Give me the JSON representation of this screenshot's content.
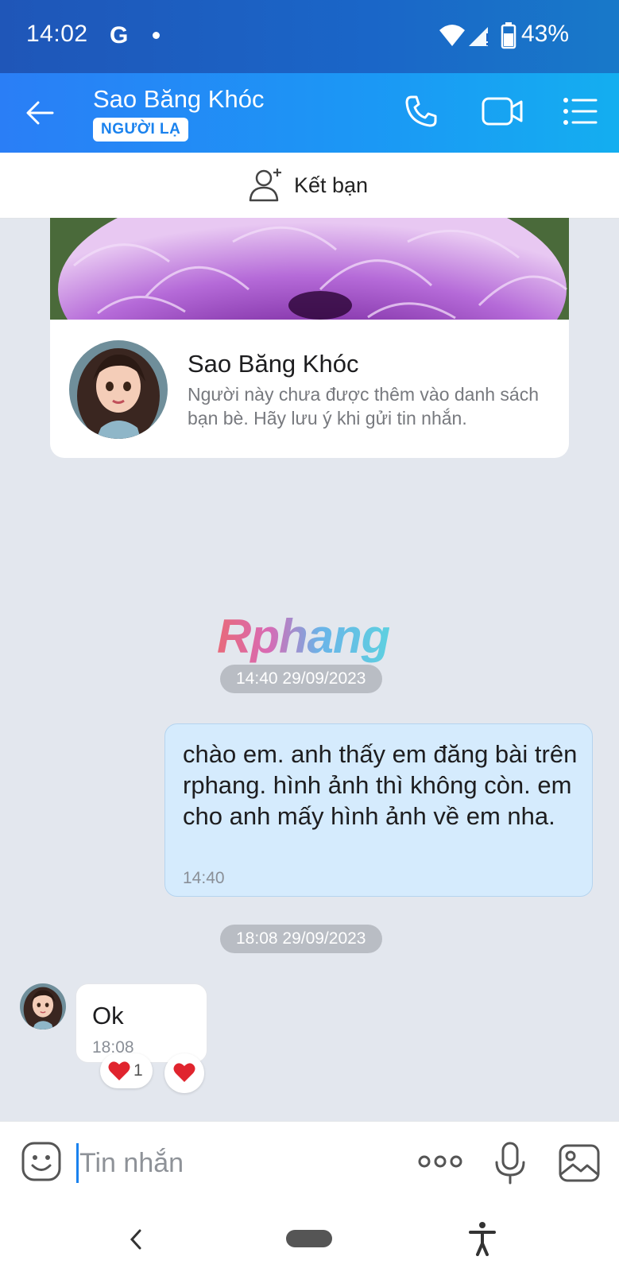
{
  "status_bar": {
    "time": "14:02",
    "google_letter": "G",
    "battery_percent": "43%"
  },
  "header": {
    "title": "Sao Băng Khóc",
    "badge": "NGƯỜI LẠ"
  },
  "add_friend": {
    "label": "Kết bạn"
  },
  "profile_card": {
    "name": "Sao Băng Khóc",
    "description": "Người này chưa được thêm vào danh sách bạn bè. Hãy lưu ý khi gửi tin nhắn."
  },
  "watermark": "Rphang",
  "messages": [
    {
      "divider": "14:40 29/09/2023",
      "direction": "outgoing",
      "text": "chào em. anh thấy em đăng bài trên rphang. hình ảnh thì không còn. em cho anh mấy hình ảnh về em nha.",
      "time": "14:40"
    },
    {
      "divider": "18:08 29/09/2023",
      "direction": "incoming",
      "text": "Ok",
      "time": "18:08",
      "reaction_count": "1"
    }
  ],
  "composer": {
    "placeholder": "Tin nhắn"
  },
  "colors": {
    "header_accent": "#1b98f5",
    "outgoing_bubble": "#d5ebfd",
    "badge_text": "#1a82ee",
    "chat_background": "#e3e7ee"
  }
}
